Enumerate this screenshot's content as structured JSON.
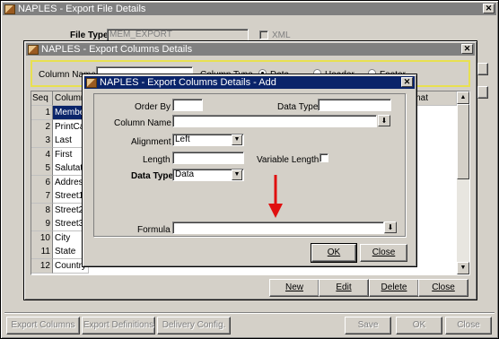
{
  "main_window": {
    "title": "NAPLES - Export File Details",
    "file_type_label": "File Type",
    "file_type_value": "MEM_EXPORT",
    "xml_label": "XML",
    "footer_buttons": {
      "export_columns": "Export Columns",
      "export_definitions": "Export Definitions",
      "delivery_config": "Delivery Config.",
      "save": "Save",
      "ok": "OK",
      "close": "Close"
    }
  },
  "columns_window": {
    "title": "NAPLES - Export Columns Details",
    "filter": {
      "column_name_label": "Column Name",
      "column_type_label": "Column Type",
      "data_label": "Data",
      "header_label": "Header",
      "footer_label": "Footer"
    },
    "grid": {
      "headers": [
        "Seq",
        "Column",
        "rmat"
      ],
      "rows": [
        {
          "seq": "1",
          "name": "Member"
        },
        {
          "seq": "2",
          "name": "PrintCar"
        },
        {
          "seq": "3",
          "name": "Last"
        },
        {
          "seq": "4",
          "name": "First"
        },
        {
          "seq": "5",
          "name": "Salutatio"
        },
        {
          "seq": "6",
          "name": "Address"
        },
        {
          "seq": "7",
          "name": "Street1"
        },
        {
          "seq": "8",
          "name": "Street2"
        },
        {
          "seq": "9",
          "name": "Street3"
        },
        {
          "seq": "10",
          "name": "City"
        },
        {
          "seq": "11",
          "name": "State"
        },
        {
          "seq": "12",
          "name": "Country"
        }
      ]
    },
    "buttons": {
      "new": "New",
      "edit": "Edit",
      "delete": "Delete",
      "close": "Close"
    }
  },
  "add_dialog": {
    "title": "NAPLES - Export Columns Details - Add",
    "order_by_label": "Order By",
    "order_by_value": "",
    "data_type_label_top": "Data Type",
    "data_type_value_top": "",
    "column_name_label": "Column Name",
    "column_name_value": "",
    "alignment_label": "Alignment",
    "alignment_value": "Left",
    "length_label": "Length",
    "length_value": "",
    "variable_length_label": "Variable Length",
    "data_type_label": "Data Type",
    "data_type_value": "Data",
    "formula_label": "Formula",
    "formula_value": "",
    "ok_label": "OK",
    "close_label": "Close"
  },
  "colors": {
    "active_title": "#0a246a",
    "inactive_title": "#808080",
    "arrow": "#e01010",
    "filter_border": "#e8e050"
  }
}
